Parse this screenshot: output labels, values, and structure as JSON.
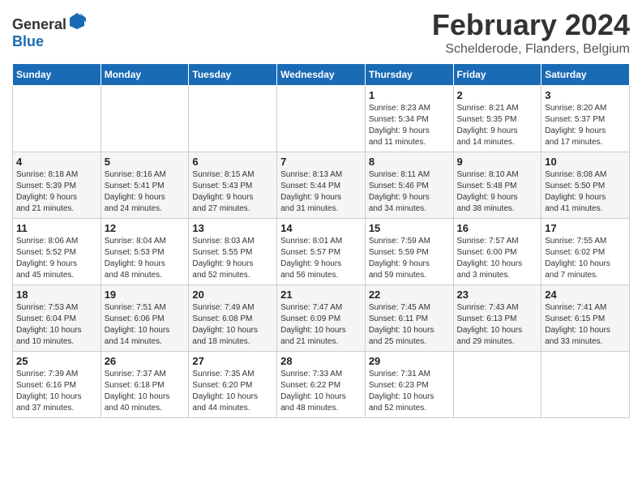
{
  "logo": {
    "general": "General",
    "blue": "Blue"
  },
  "title": "February 2024",
  "location": "Schelderode, Flanders, Belgium",
  "days_of_week": [
    "Sunday",
    "Monday",
    "Tuesday",
    "Wednesday",
    "Thursday",
    "Friday",
    "Saturday"
  ],
  "weeks": [
    [
      {
        "day": "",
        "info": ""
      },
      {
        "day": "",
        "info": ""
      },
      {
        "day": "",
        "info": ""
      },
      {
        "day": "",
        "info": ""
      },
      {
        "day": "1",
        "info": "Sunrise: 8:23 AM\nSunset: 5:34 PM\nDaylight: 9 hours\nand 11 minutes."
      },
      {
        "day": "2",
        "info": "Sunrise: 8:21 AM\nSunset: 5:35 PM\nDaylight: 9 hours\nand 14 minutes."
      },
      {
        "day": "3",
        "info": "Sunrise: 8:20 AM\nSunset: 5:37 PM\nDaylight: 9 hours\nand 17 minutes."
      }
    ],
    [
      {
        "day": "4",
        "info": "Sunrise: 8:18 AM\nSunset: 5:39 PM\nDaylight: 9 hours\nand 21 minutes."
      },
      {
        "day": "5",
        "info": "Sunrise: 8:16 AM\nSunset: 5:41 PM\nDaylight: 9 hours\nand 24 minutes."
      },
      {
        "day": "6",
        "info": "Sunrise: 8:15 AM\nSunset: 5:43 PM\nDaylight: 9 hours\nand 27 minutes."
      },
      {
        "day": "7",
        "info": "Sunrise: 8:13 AM\nSunset: 5:44 PM\nDaylight: 9 hours\nand 31 minutes."
      },
      {
        "day": "8",
        "info": "Sunrise: 8:11 AM\nSunset: 5:46 PM\nDaylight: 9 hours\nand 34 minutes."
      },
      {
        "day": "9",
        "info": "Sunrise: 8:10 AM\nSunset: 5:48 PM\nDaylight: 9 hours\nand 38 minutes."
      },
      {
        "day": "10",
        "info": "Sunrise: 8:08 AM\nSunset: 5:50 PM\nDaylight: 9 hours\nand 41 minutes."
      }
    ],
    [
      {
        "day": "11",
        "info": "Sunrise: 8:06 AM\nSunset: 5:52 PM\nDaylight: 9 hours\nand 45 minutes."
      },
      {
        "day": "12",
        "info": "Sunrise: 8:04 AM\nSunset: 5:53 PM\nDaylight: 9 hours\nand 48 minutes."
      },
      {
        "day": "13",
        "info": "Sunrise: 8:03 AM\nSunset: 5:55 PM\nDaylight: 9 hours\nand 52 minutes."
      },
      {
        "day": "14",
        "info": "Sunrise: 8:01 AM\nSunset: 5:57 PM\nDaylight: 9 hours\nand 56 minutes."
      },
      {
        "day": "15",
        "info": "Sunrise: 7:59 AM\nSunset: 5:59 PM\nDaylight: 9 hours\nand 59 minutes."
      },
      {
        "day": "16",
        "info": "Sunrise: 7:57 AM\nSunset: 6:00 PM\nDaylight: 10 hours\nand 3 minutes."
      },
      {
        "day": "17",
        "info": "Sunrise: 7:55 AM\nSunset: 6:02 PM\nDaylight: 10 hours\nand 7 minutes."
      }
    ],
    [
      {
        "day": "18",
        "info": "Sunrise: 7:53 AM\nSunset: 6:04 PM\nDaylight: 10 hours\nand 10 minutes."
      },
      {
        "day": "19",
        "info": "Sunrise: 7:51 AM\nSunset: 6:06 PM\nDaylight: 10 hours\nand 14 minutes."
      },
      {
        "day": "20",
        "info": "Sunrise: 7:49 AM\nSunset: 6:08 PM\nDaylight: 10 hours\nand 18 minutes."
      },
      {
        "day": "21",
        "info": "Sunrise: 7:47 AM\nSunset: 6:09 PM\nDaylight: 10 hours\nand 21 minutes."
      },
      {
        "day": "22",
        "info": "Sunrise: 7:45 AM\nSunset: 6:11 PM\nDaylight: 10 hours\nand 25 minutes."
      },
      {
        "day": "23",
        "info": "Sunrise: 7:43 AM\nSunset: 6:13 PM\nDaylight: 10 hours\nand 29 minutes."
      },
      {
        "day": "24",
        "info": "Sunrise: 7:41 AM\nSunset: 6:15 PM\nDaylight: 10 hours\nand 33 minutes."
      }
    ],
    [
      {
        "day": "25",
        "info": "Sunrise: 7:39 AM\nSunset: 6:16 PM\nDaylight: 10 hours\nand 37 minutes."
      },
      {
        "day": "26",
        "info": "Sunrise: 7:37 AM\nSunset: 6:18 PM\nDaylight: 10 hours\nand 40 minutes."
      },
      {
        "day": "27",
        "info": "Sunrise: 7:35 AM\nSunset: 6:20 PM\nDaylight: 10 hours\nand 44 minutes."
      },
      {
        "day": "28",
        "info": "Sunrise: 7:33 AM\nSunset: 6:22 PM\nDaylight: 10 hours\nand 48 minutes."
      },
      {
        "day": "29",
        "info": "Sunrise: 7:31 AM\nSunset: 6:23 PM\nDaylight: 10 hours\nand 52 minutes."
      },
      {
        "day": "",
        "info": ""
      },
      {
        "day": "",
        "info": ""
      }
    ]
  ]
}
